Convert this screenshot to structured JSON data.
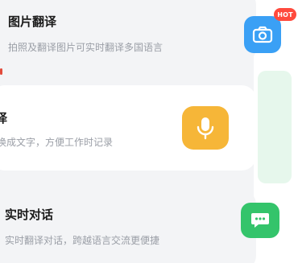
{
  "features": [
    {
      "title": "图片翻译",
      "subtitle": "拍照及翻译图片可实时翻译多国语言",
      "icon": "camera-icon",
      "icon_color": "#3aa0f5",
      "badge": "HOT"
    },
    {
      "title": "译",
      "subtitle": "换成文字，方便工作时记录",
      "icon": "microphone-icon",
      "icon_color": "#f6b638"
    },
    {
      "title": "实时对话",
      "subtitle": "实时翻译对话，跨越语言交流更便捷",
      "icon": "chat-bubble-icon",
      "icon_color": "#34c46b"
    }
  ]
}
